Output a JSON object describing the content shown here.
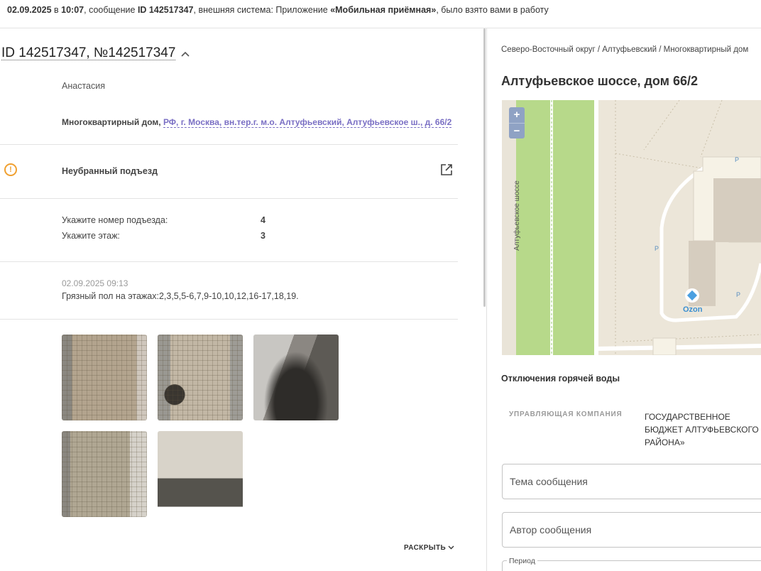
{
  "notification": {
    "date": "02.09.2025",
    "in": " в ",
    "time": "10:07",
    "msg_prefix": ", сообщение ",
    "id": "ID 142517347",
    "ext_prefix": ", внешняя система: Приложение ",
    "system": "«Мобильная приёмная»",
    "suffix": ", было взято вами в работу"
  },
  "ticket": {
    "title": "ID 142517347, №142517347",
    "author": "Анастасия",
    "object_type": "Многоквартирный дом, ",
    "address_link": "РФ, г. Москва, вн.тер.г. м.о. Алтуфьевский, Алтуфьевское ш., д. 66/2",
    "category": "Неубранный подъезд",
    "fields": [
      {
        "label": "Укажите номер подъезда:",
        "value": "4"
      },
      {
        "label": "Укажите этаж:",
        "value": "3"
      }
    ],
    "message_date": "02.09.2025 09:13",
    "message_text": "Грязный пол на этажах:2,3,5,5-6,7,9-10,10,12,16-17,18,19.",
    "photos_count": 5,
    "expand_label": "РАСКРЫТЬ"
  },
  "building": {
    "breadcrumb": "Северо-Восточный округ / Алтуфьевский / Многоквартирный дом",
    "address": "Алтуфьевское шоссе, дом 66/2",
    "map": {
      "street_label": "Алтуфьевское шоссе",
      "poi_label": "Ozon",
      "zoom_in": "+",
      "zoom_out": "−",
      "parking": "P"
    },
    "hot_water_title": "Отключения горячей воды",
    "mc_label": "УПРАВЛЯЮЩАЯ КОМПАНИЯ",
    "mc_value": "ГОСУДАРСТВЕННОЕ БЮДЖЕТ АЛТУФЬЕВСКОГО РАЙОНА»"
  },
  "form": {
    "subject_placeholder": "Тема сообщения",
    "author_placeholder": "Автор сообщения",
    "period_label": "Период"
  },
  "colors": {
    "link": "#7a6fc4",
    "warning": "#f0a030",
    "map_road_green": "#b7d98a"
  }
}
